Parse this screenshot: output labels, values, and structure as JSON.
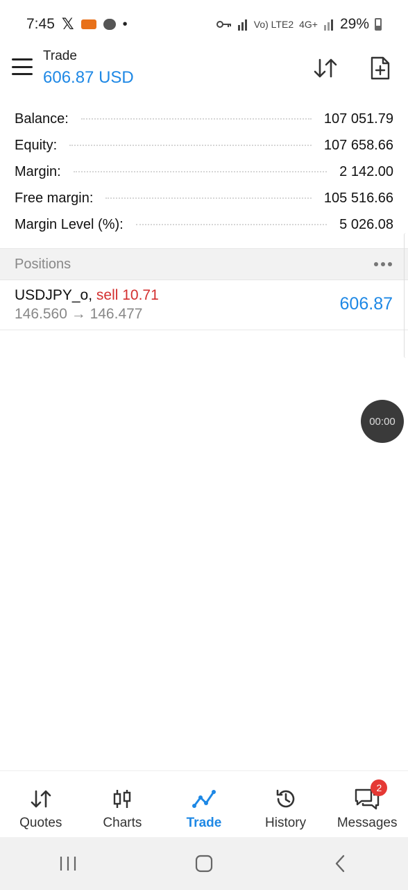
{
  "status_bar": {
    "time": "7:45",
    "x_label": "𝕏",
    "network_small": "Vo) LTE2",
    "network_4g": "4G+",
    "battery": "29%"
  },
  "app_bar": {
    "title": "Trade",
    "profit": "606.87 USD"
  },
  "summary": {
    "rows": [
      {
        "label": "Balance:",
        "value": "107 051.79"
      },
      {
        "label": "Equity:",
        "value": "107 658.66"
      },
      {
        "label": "Margin:",
        "value": "2 142.00"
      },
      {
        "label": "Free margin:",
        "value": "105 516.66"
      },
      {
        "label": "Margin Level (%):",
        "value": "5 026.08"
      }
    ]
  },
  "positions": {
    "header": "Positions",
    "items": [
      {
        "symbol": "USDJPY_o,",
        "side": "sell 10.71",
        "prices": "146.560 → 146.477",
        "profit": "606.87"
      }
    ]
  },
  "timer": "00:00",
  "bottom_nav": {
    "items": [
      {
        "label": "Quotes",
        "icon": "quotes-icon"
      },
      {
        "label": "Charts",
        "icon": "charts-icon"
      },
      {
        "label": "Trade",
        "icon": "trade-icon",
        "active": true
      },
      {
        "label": "History",
        "icon": "history-icon"
      },
      {
        "label": "Messages",
        "icon": "messages-icon",
        "badge": "2"
      }
    ]
  },
  "colors": {
    "accent": "#1e88e5",
    "sell": "#d32f2f",
    "badge": "#e53935"
  }
}
